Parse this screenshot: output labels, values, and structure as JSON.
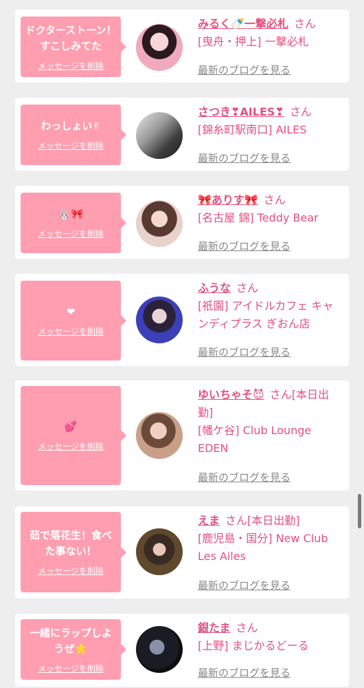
{
  "common": {
    "delete_label": "メッセージを削除",
    "honorific": "さん",
    "blog_link": "最新のブログを見る"
  },
  "entries": [
    {
      "message": "ドクターストーン！すこしみてた",
      "name": "みるく🍼一撃必札",
      "status": "",
      "shop": "[曳舟・押上] 一撃必札"
    },
    {
      "message": "わっしょい✌",
      "name": "さつき❣AILES❣",
      "status": "",
      "shop": "[錦糸町駅南口] AILES"
    },
    {
      "message": "🐰🎀",
      "name": "🎀ありす🎀",
      "status": "",
      "shop": "[名古屋 錦] Teddy Bear"
    },
    {
      "message": "❤",
      "name": "ふうな",
      "status": "",
      "shop": "[祇園] アイドルカフェ キャンディプラス ぎおん店"
    },
    {
      "message": "💕",
      "name": "ゆいちゃそ😈",
      "status": "[本日出勤]",
      "shop": "[幡ケ谷] Club Lounge EDEN"
    },
    {
      "message": "茹で落花生！食べた事ない！",
      "name": "えま",
      "status": "[本日出勤]",
      "shop": "[鹿児島・国分] New Club Les Ailes"
    },
    {
      "message": "一緒にラップしようぜ⭐",
      "name": "銀たま",
      "status": "",
      "shop": "[上野] まじかるどーる"
    }
  ],
  "colors": {
    "accent": "#e2517e",
    "bubble": "#ff9eb0",
    "background": "#eeeeee",
    "link_gray": "#888888"
  }
}
